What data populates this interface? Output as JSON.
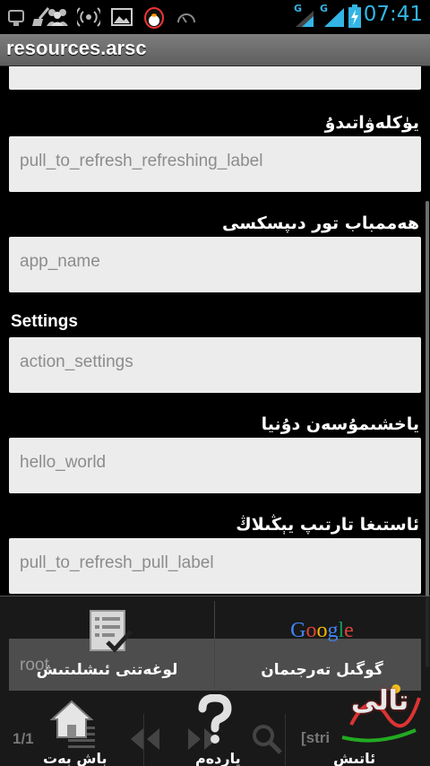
{
  "status_bar": {
    "time": "07:41",
    "network_1": "G",
    "network_2": "G",
    "icons": [
      "usb-debug-icon",
      "broom-icon",
      "people-icon",
      "wifi-hotspot-icon",
      "image-icon",
      "penguin-icon",
      "speed-icon",
      "signal-icon",
      "signal-icon",
      "battery-charging-icon"
    ]
  },
  "title_bar": {
    "title": "resources.arsc"
  },
  "fields": [
    {
      "label": "يۈكلەۋاتىدۇ",
      "value": "pull_to_refresh_refreshing_label"
    },
    {
      "label": "ھەممباب تور دىپسكسى",
      "value": "app_name"
    },
    {
      "label": "Settings",
      "value": "action_settings"
    },
    {
      "label": "ياخشىمۇسەن دۇنيا",
      "value": "hello_world"
    },
    {
      "label": "ئاستىغا تارتىپ يېڭىلاڭ",
      "value": "pull_to_refresh_pull_label"
    }
  ],
  "overlay_row": {
    "value": "root"
  },
  "menu": {
    "check_label": "لوغەتنى ئىشلىتىش",
    "google_label": "گوگىل تەرجىمان",
    "google_logo": "Google"
  },
  "toolbar": {
    "page_count": "1/1",
    "home_label": "باش بەت",
    "help_label": "ياردەم",
    "search_label": "ئاتىش",
    "string_tag": "[stri",
    "watermark": "تالى"
  },
  "colors": {
    "accent": "#33b5e5",
    "field_bg": "#ececec",
    "field_text": "#8c8c8c",
    "google_blue": "#4285f4",
    "google_red": "#db4437",
    "google_yellow": "#f4b400",
    "google_green": "#0f9d58"
  }
}
